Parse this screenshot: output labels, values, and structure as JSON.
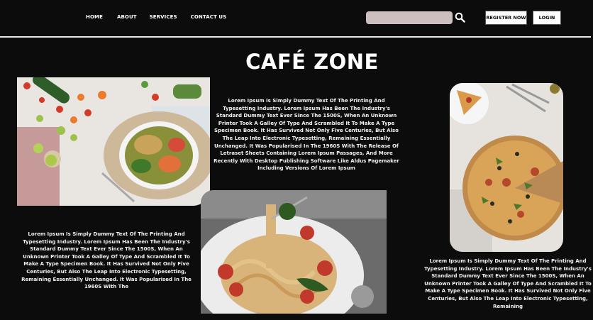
{
  "header": {
    "nav": [
      "HOME",
      "ABOUT",
      "SERVICES",
      "CONTACT US"
    ],
    "search": {
      "value": "",
      "placeholder": ""
    },
    "register_label": "REGISTER NOW",
    "login_label": "LOGIN"
  },
  "hero": {
    "title": "CAFÉ ZONE"
  },
  "texts": {
    "center": "Lorem Ipsum Is Simply Dummy Text Of The Printing And Typesetting Industry. Lorem Ipsum Has Been The Industry's Standard Dummy Text Ever Since The 1500S, When An Unknown Printer Took A Galley Of Type And Scrambled It To Make A Type Specimen Book. It Has Survived Not Only Five Centuries, But Also The Leap Into Electronic Typesetting, Remaining Essentially Unchanged. It Was Popularised In The 1960S With The Release Of Letraset Sheets Containing Lorem Ipsum Passages, And More Recently With Desktop Publishing Software Like Aldus Pagemaker Including Versions Of Lorem Ipsum",
    "left": "Lorem Ipsum Is Simply Dummy Text Of The Printing And Typesetting Industry. Lorem Ipsum Has Been The Industry's Standard Dummy Text Ever Since The 1500S, When An Unknown Printer Took A Galley Of Type And Scrambled It To Make A Type Specimen Book. It Has Survived Not Only Five Centuries, But Also The Leap Into Electronic Typesetting, Remaining Essentially Unchanged. It Was Popularised In The 1960S With The",
    "right": "Lorem Ipsum Is Simply Dummy Text Of The Printing And Typesetting Industry. Lorem Ipsum Has Been The Industry's Standard Dummy Text Ever Since The 1500S, When An Unknown Printer Took A Galley Of Type And Scrambled It To Make A Type Specimen Book. It Has Survived Not Only Five Centuries, But Also The Leap Into Electronic Typesetting, Remaining"
  },
  "icons": {
    "search": "search-icon"
  },
  "colors": {
    "background": "#0c0c0c",
    "search_field": "#cdbfbf",
    "divider": "#e8e8e8",
    "button_bg": "#ffffff"
  }
}
